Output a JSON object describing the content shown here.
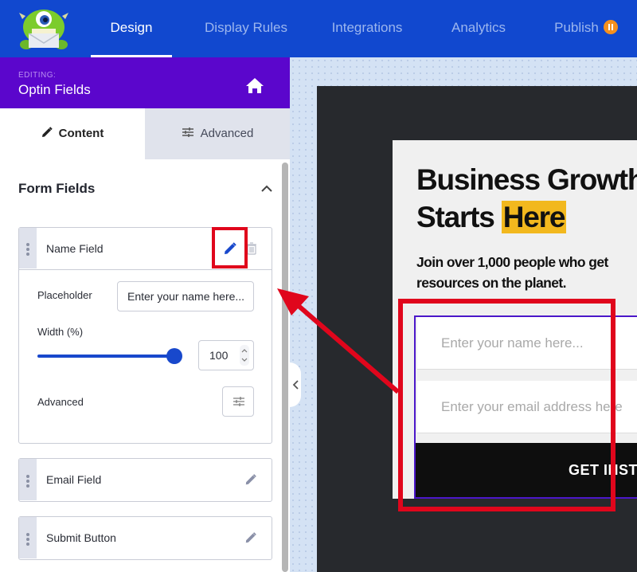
{
  "app": {
    "logo": "optinmonster-logo",
    "nav": [
      {
        "label": "Design",
        "active": true
      },
      {
        "label": "Display Rules",
        "active": false
      },
      {
        "label": "Integrations",
        "active": false
      },
      {
        "label": "Analytics",
        "active": false
      },
      {
        "label": "Publish",
        "active": false,
        "badge": "pause-icon"
      }
    ],
    "colors": {
      "nav_bg": "#1148cf",
      "editing_bg": "#5b06cc",
      "accent_blue": "#1848cc",
      "annotation_red": "#e0061c",
      "highlight_yellow": "#f2b81e",
      "publish_badge": "#f5901e"
    }
  },
  "editing": {
    "label": "EDITING:",
    "title": "Optin Fields",
    "home_icon": "home-icon"
  },
  "sidebar": {
    "tabs": [
      {
        "label": "Content",
        "icon": "pencil-icon",
        "active": true
      },
      {
        "label": "Advanced",
        "icon": "sliders-icon",
        "active": false
      }
    ],
    "section_title": "Form Fields",
    "fields": [
      {
        "name": "Name Field",
        "expanded": true,
        "placeholder_label": "Placeholder",
        "placeholder_value": "Enter your name here...",
        "width_label": "Width (%)",
        "width_value": "100",
        "width_percent": 100,
        "advanced_label": "Advanced"
      },
      {
        "name": "Email Field",
        "expanded": false
      },
      {
        "name": "Submit Button",
        "expanded": false
      }
    ]
  },
  "preview": {
    "headline_line1": "Business Growth",
    "headline_line2_a": "Starts ",
    "headline_line2_b": "Here",
    "subhead_line1": "Join over 1,000 people who get",
    "subhead_line2": "resources on the planet.",
    "name_placeholder": "Enter your name here...",
    "email_placeholder": "Enter your email address here",
    "cta_label": "GET INSTANT ACCESS"
  }
}
